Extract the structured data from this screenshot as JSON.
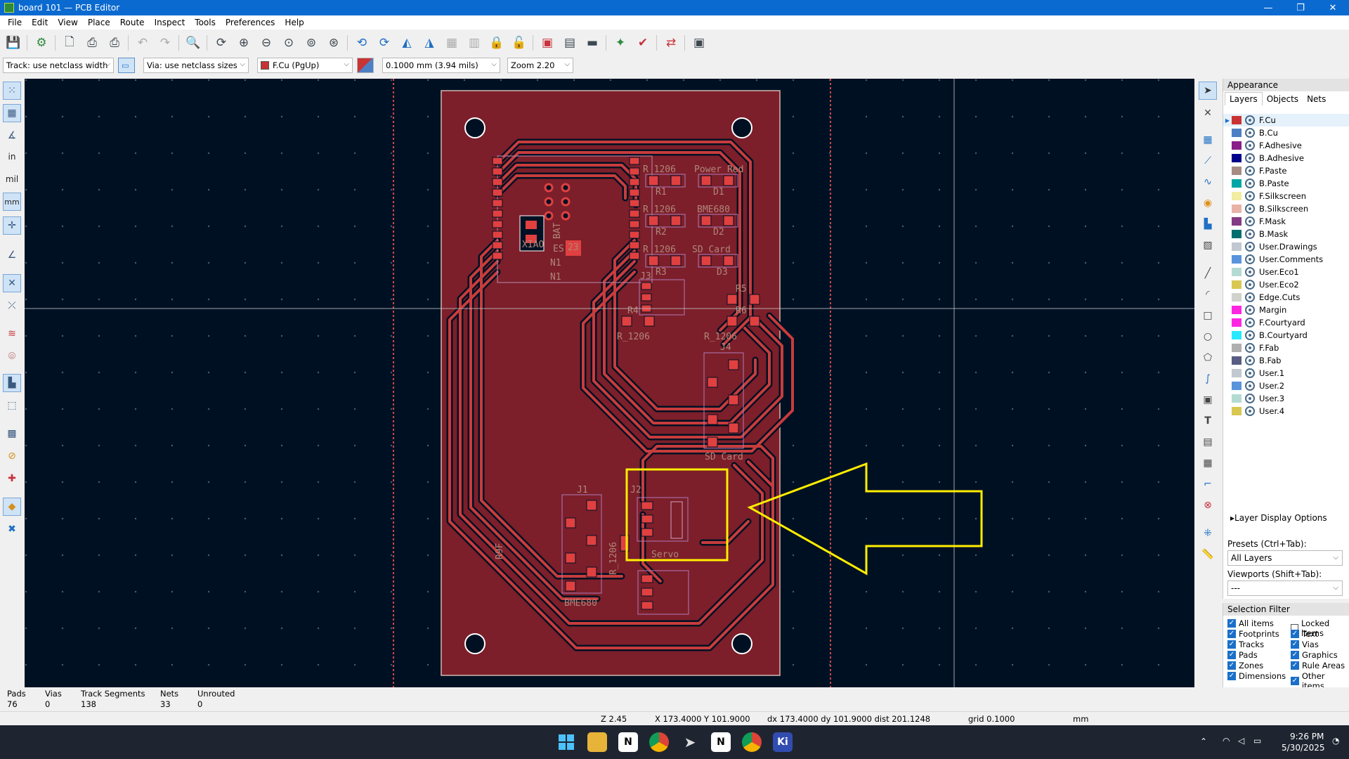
{
  "window": {
    "title": "board 101 — PCB Editor",
    "controls": [
      "—",
      "❐",
      "✕"
    ]
  },
  "menu": [
    "File",
    "Edit",
    "View",
    "Place",
    "Route",
    "Inspect",
    "Tools",
    "Preferences",
    "Help"
  ],
  "toolbar2": {
    "track": "Track: use netclass width",
    "via": "Via: use netclass sizes",
    "layer": "F.Cu (PgUp)",
    "grid": "0.1000 mm (3.94 mils)",
    "zoom": "Zoom 2.20"
  },
  "colors": {
    "canvas_bg": "#001023",
    "board_fill": "#7c1f2a",
    "copper": "#c83c3c",
    "annotation": "#ffee00"
  },
  "left_tools": {
    "units_in": "in",
    "units_mil": "mil",
    "units_mm": "mm"
  },
  "silkscreen": {
    "r1_fp": "R_1206",
    "r1": "R1",
    "d1_fp": "Power Red",
    "d1": "D1",
    "r2_fp": "R_1206",
    "r2": "R2",
    "d2_fp": "BME680",
    "d2": "D2",
    "r3_fp": "R_1206",
    "r3": "R3",
    "d3_fp": "SD Card",
    "d3": "D3",
    "j3": "J3",
    "r5": "R5",
    "r4": "R4",
    "r4_fp": "R_1206",
    "r6": "R6",
    "r6_fp": "R_1206",
    "j4": "J4",
    "sdcard": "SD Card",
    "j1": "J1",
    "j2": "J2",
    "servo": "Servo",
    "bme680": "BME680",
    "r_vert": "R_1206",
    "rp": "R9F",
    "xiao": "XIAO",
    "bat": "BAT",
    "n1": "N1",
    "n1b": "N1",
    "es": "ES",
    "chip": "23"
  },
  "appearance": {
    "title": "Appearance",
    "tabs": [
      "Layers",
      "Objects",
      "Nets"
    ],
    "layers": [
      {
        "name": "F.Cu",
        "color": "#c83434"
      },
      {
        "name": "B.Cu",
        "color": "#4d7fc4"
      },
      {
        "name": "F.Adhesive",
        "color": "#8a1e8a"
      },
      {
        "name": "B.Adhesive",
        "color": "#00008a"
      },
      {
        "name": "F.Paste",
        "color": "#a68c84"
      },
      {
        "name": "B.Paste",
        "color": "#00a6a6"
      },
      {
        "name": "F.Silkscreen",
        "color": "#f2eda1"
      },
      {
        "name": "B.Silkscreen",
        "color": "#e8b2a7"
      },
      {
        "name": "F.Mask",
        "color": "#843a84"
      },
      {
        "name": "B.Mask",
        "color": "#026e6e"
      },
      {
        "name": "User.Drawings",
        "color": "#c2c8d0"
      },
      {
        "name": "User.Comments",
        "color": "#5994dc"
      },
      {
        "name": "User.Eco1",
        "color": "#b4dbd2"
      },
      {
        "name": "User.Eco2",
        "color": "#d8c852"
      },
      {
        "name": "Edge.Cuts",
        "color": "#d0d2cd"
      },
      {
        "name": "Margin",
        "color": "#ff26e2"
      },
      {
        "name": "F.Courtyard",
        "color": "#ff26e2"
      },
      {
        "name": "B.Courtyard",
        "color": "#26e9ff"
      },
      {
        "name": "F.Fab",
        "color": "#afafaf"
      },
      {
        "name": "B.Fab",
        "color": "#585d84"
      },
      {
        "name": "User.1",
        "color": "#c2c8d0"
      },
      {
        "name": "User.2",
        "color": "#5994dc"
      },
      {
        "name": "User.3",
        "color": "#b4dbd2"
      },
      {
        "name": "User.4",
        "color": "#d8c852"
      }
    ],
    "layer_display_options": "Layer Display Options",
    "presets_label": "Presets (Ctrl+Tab):",
    "presets_value": "All Layers",
    "viewports_label": "Viewports (Shift+Tab):",
    "viewports_value": "---"
  },
  "selection_filter": {
    "title": "Selection Filter",
    "items": [
      {
        "label": "All items",
        "checked": true
      },
      {
        "label": "Locked items",
        "checked": false
      },
      {
        "label": "Footprints",
        "checked": true
      },
      {
        "label": "Text",
        "checked": true
      },
      {
        "label": "Tracks",
        "checked": true
      },
      {
        "label": "Vias",
        "checked": true
      },
      {
        "label": "Pads",
        "checked": true
      },
      {
        "label": "Graphics",
        "checked": true
      },
      {
        "label": "Zones",
        "checked": true
      },
      {
        "label": "Rule Areas",
        "checked": true
      },
      {
        "label": "Dimensions",
        "checked": true
      },
      {
        "label": "Other items",
        "checked": true
      }
    ]
  },
  "board_stats": {
    "pads_label": "Pads",
    "pads": "76",
    "vias_label": "Vias",
    "vias": "0",
    "tracks_label": "Track Segments",
    "tracks": "138",
    "nets_label": "Nets",
    "nets": "33",
    "unrouted_label": "Unrouted",
    "unrouted": "0"
  },
  "statusbar": {
    "z": "Z 2.45",
    "xy": "X 173.4000  Y 101.9000",
    "dxy": "dx 173.4000  dy 101.9000  dist 201.1248",
    "grid": "grid 0.1000",
    "units": "mm"
  },
  "taskbar": {
    "time": "9:26 PM",
    "date": "5/30/2025"
  }
}
